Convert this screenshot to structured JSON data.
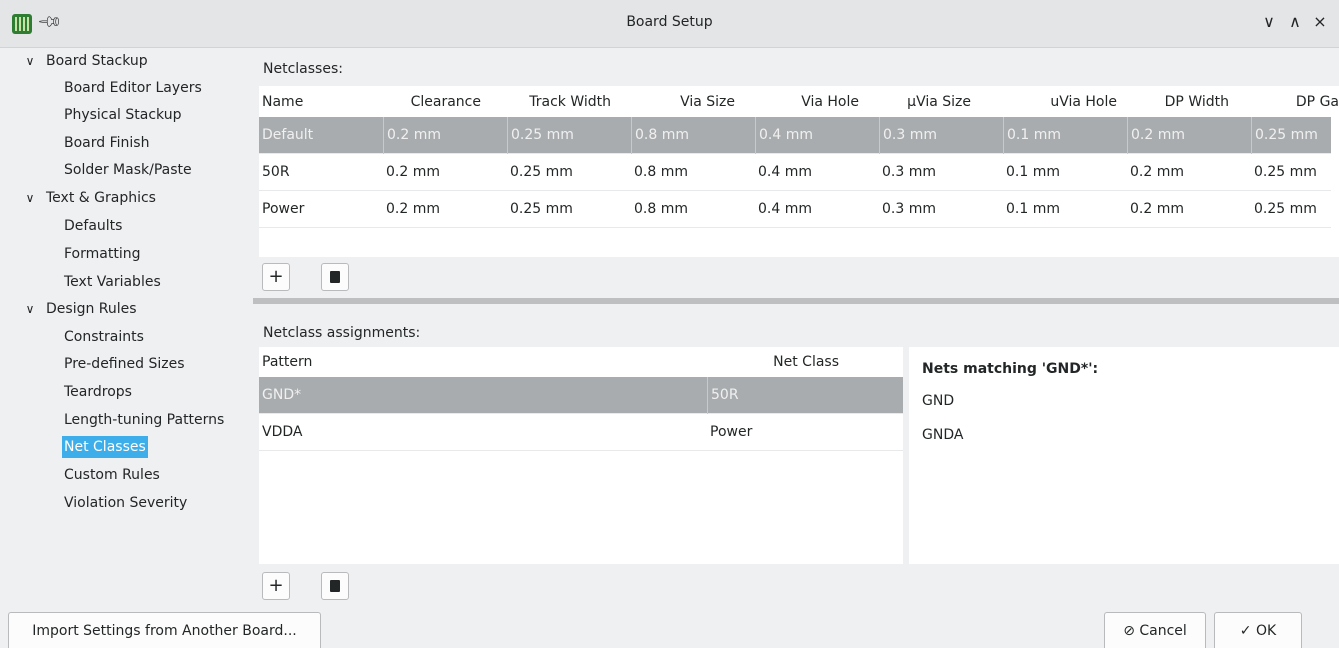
{
  "window": {
    "title": "Board Setup",
    "pin_icon": "pin-icon",
    "controls": [
      "∨",
      "∧",
      "×"
    ]
  },
  "sidebar": {
    "groups": [
      {
        "label": "Board Stackup",
        "items": [
          "Board Editor Layers",
          "Physical Stackup",
          "Board Finish",
          "Solder Mask/Paste"
        ]
      },
      {
        "label": "Text & Graphics",
        "items": [
          "Defaults",
          "Formatting",
          "Text Variables"
        ]
      },
      {
        "label": "Design Rules",
        "items": [
          "Constraints",
          "Pre-defined Sizes",
          "Teardrops",
          "Length-tuning Patterns",
          "Net Classes",
          "Custom Rules",
          "Violation Severity"
        ]
      }
    ],
    "selected": "Net Classes"
  },
  "netclasses": {
    "label": "Netclasses:",
    "columns": [
      "Name",
      "Clearance",
      "Track Width",
      "Via Size",
      "Via Hole",
      "µVia Size",
      "uVia Hole",
      "DP Width",
      "DP Ga"
    ],
    "rows": [
      [
        "Default",
        "0.2 mm",
        "0.25 mm",
        "0.8 mm",
        "0.4 mm",
        "0.3 mm",
        "0.1 mm",
        "0.2 mm",
        "0.25 mm"
      ],
      [
        "50R",
        "0.2 mm",
        "0.25 mm",
        "0.8 mm",
        "0.4 mm",
        "0.3 mm",
        "0.1 mm",
        "0.2 mm",
        "0.25 mm"
      ],
      [
        "Power",
        "0.2 mm",
        "0.25 mm",
        "0.8 mm",
        "0.4 mm",
        "0.3 mm",
        "0.1 mm",
        "0.2 mm",
        "0.25 mm"
      ]
    ],
    "selected_row": 0,
    "add_icon": "plus-icon",
    "delete_icon": "trash-icon"
  },
  "assignments": {
    "label": "Netclass assignments:",
    "columns": [
      "Pattern",
      "Net Class"
    ],
    "rows": [
      [
        "GND*",
        "50R"
      ],
      [
        "VDDA",
        "Power"
      ]
    ],
    "selected_row": 0,
    "add_icon": "plus-icon",
    "delete_icon": "trash-icon"
  },
  "nets_matching": {
    "title": "Nets matching 'GND*':",
    "nets": [
      "GND",
      "GNDA"
    ]
  },
  "footer": {
    "import_label": "Import Settings from Another Board...",
    "cancel_label": "Cancel",
    "ok_label": "OK"
  },
  "colors": {
    "selection_blue": "#3daee9",
    "selected_row_gray": "#a9acae"
  }
}
